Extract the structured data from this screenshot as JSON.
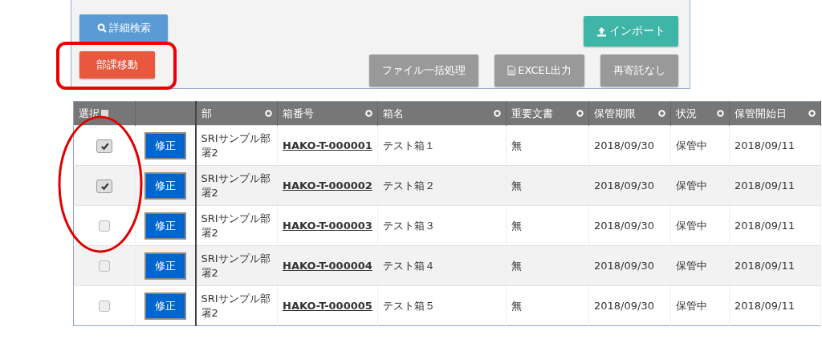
{
  "toolbar": {
    "buttons": [
      {
        "label": "詳細検索",
        "kind": "search"
      },
      {
        "label": "インポート",
        "kind": "import"
      },
      {
        "label": "部課移動",
        "kind": "danger"
      },
      {
        "label": "ファイル一括処理",
        "kind": "plain"
      },
      {
        "label": "EXCEL出力",
        "kind": "export"
      },
      {
        "label": "再寄託なし",
        "kind": "plain"
      }
    ]
  },
  "table": {
    "select_header": {
      "label": "選択",
      "checked": false
    },
    "columns": [
      "部",
      "箱番号",
      "箱名",
      "重要文書",
      "保管期限",
      "状況",
      "保管開始日"
    ],
    "rows": [
      {
        "checked": true,
        "edit": "修正",
        "dept": "SRIサンプル部署2",
        "box_no": "HAKO-T-000001",
        "box_name": "テスト箱１",
        "important": "無",
        "deadline": "2018/09/30",
        "status": "保管中",
        "start": "2018/09/11"
      },
      {
        "checked": true,
        "edit": "修正",
        "dept": "SRIサンプル部署2",
        "box_no": "HAKO-T-000002",
        "box_name": "テスト箱２",
        "important": "無",
        "deadline": "2018/09/30",
        "status": "保管中",
        "start": "2018/09/11"
      },
      {
        "checked": false,
        "edit": "修正",
        "dept": "SRIサンプル部署2",
        "box_no": "HAKO-T-000003",
        "box_name": "テスト箱３",
        "important": "無",
        "deadline": "2018/09/30",
        "status": "保管中",
        "start": "2018/09/11"
      },
      {
        "checked": false,
        "edit": "修正",
        "dept": "SRIサンプル部署2",
        "box_no": "HAKO-T-000004",
        "box_name": "テスト箱４",
        "important": "無",
        "deadline": "2018/09/30",
        "status": "保管中",
        "start": "2018/09/11"
      },
      {
        "checked": false,
        "edit": "修正",
        "dept": "SRIサンプル部署2",
        "box_no": "HAKO-T-000005",
        "box_name": "テスト箱５",
        "important": "無",
        "deadline": "2018/09/30",
        "status": "保管中",
        "start": "2018/09/11"
      }
    ]
  }
}
